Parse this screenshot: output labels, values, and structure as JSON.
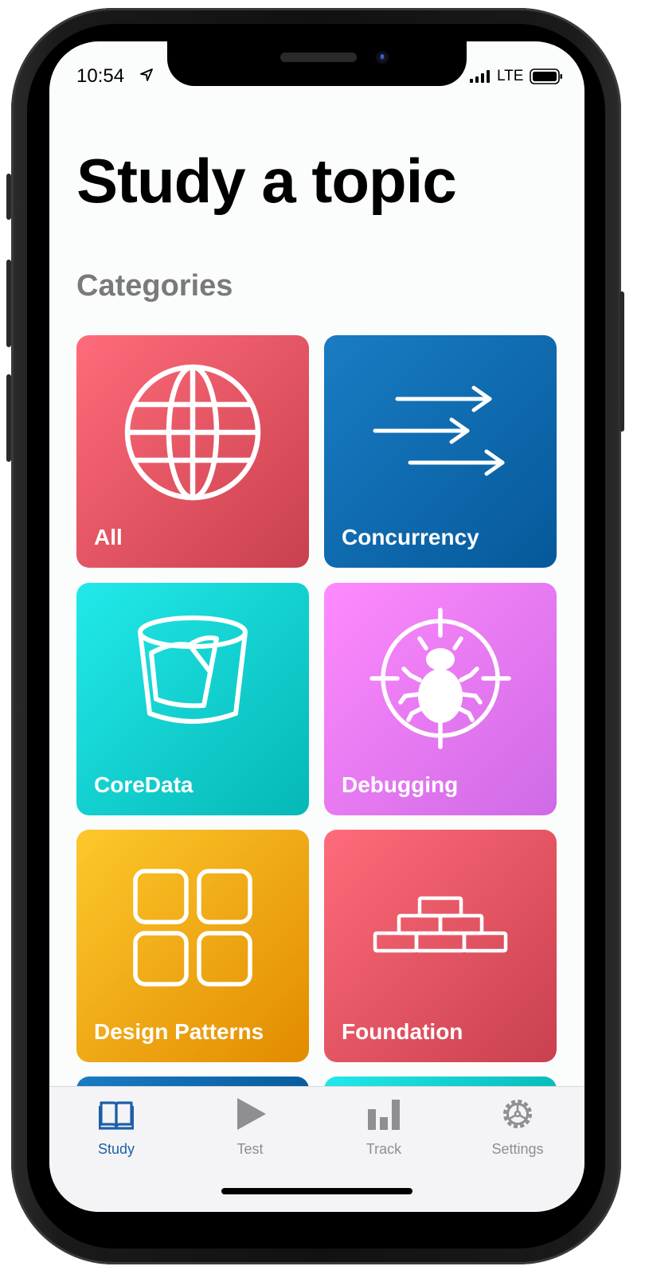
{
  "status": {
    "time": "10:54",
    "network": "LTE"
  },
  "page": {
    "title": "Study a topic",
    "section": "Categories"
  },
  "categories": [
    {
      "label": "All",
      "icon": "globe-icon",
      "color_from": "#ff6b7a",
      "color_to": "#c9404e"
    },
    {
      "label": "Concurrency",
      "icon": "arrows-icon",
      "color_from": "#1a7cc4",
      "color_to": "#05599a"
    },
    {
      "label": "CoreData",
      "icon": "database-icon",
      "color_from": "#22e9ea",
      "color_to": "#05b8b6"
    },
    {
      "label": "Debugging",
      "icon": "bug-target-icon",
      "color_from": "#ff8afd",
      "color_to": "#cf6ae6"
    },
    {
      "label": "Design Patterns",
      "icon": "grid-icon",
      "color_from": "#fdc82c",
      "color_to": "#e28b00"
    },
    {
      "label": "Foundation",
      "icon": "bricks-icon",
      "color_from": "#ff6b7a",
      "color_to": "#c9404e"
    }
  ],
  "tabs": [
    {
      "label": "Study",
      "icon": "book-icon",
      "active": true
    },
    {
      "label": "Test",
      "icon": "play-icon",
      "active": false
    },
    {
      "label": "Track",
      "icon": "bar-chart-icon",
      "active": false
    },
    {
      "label": "Settings",
      "icon": "gear-icon",
      "active": false
    }
  ],
  "colors": {
    "accent": "#1c5fa8",
    "inactive": "#8e8e93"
  }
}
